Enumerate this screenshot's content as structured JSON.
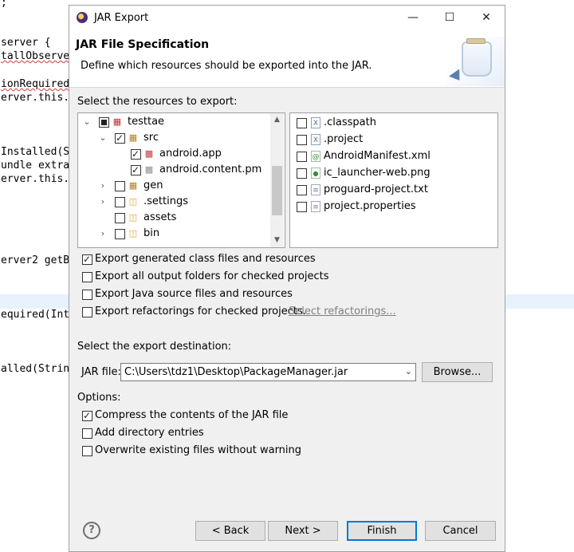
{
  "editor": {
    "lines": [
      ";",
      "server {",
      "tallObserve",
      "ionRequired",
      "erver.this.",
      "Installed(S",
      "undle extra",
      "erver.this.",
      "erver2 getB",
      "equired(Int",
      "alled(Strin"
    ]
  },
  "dialog": {
    "title": "JAR Export",
    "header": {
      "title": "JAR File Specification",
      "description": "Define which resources should be exported into the JAR."
    },
    "resources_label": "Select the resources to export:",
    "tree": [
      {
        "label": "testtae",
        "state": "partial",
        "expanded": true,
        "icon": "project-icon"
      },
      {
        "label": "src",
        "state": "checked",
        "expanded": true,
        "icon": "source-folder-icon"
      },
      {
        "label": "android.app",
        "state": "checked",
        "icon": "package-icon"
      },
      {
        "label": "android.content.pm",
        "state": "checked",
        "icon": "package-empty-icon"
      },
      {
        "label": "gen",
        "state": "unchecked",
        "expanded": false,
        "icon": "source-folder-icon"
      },
      {
        "label": ".settings",
        "state": "unchecked",
        "expanded": false,
        "icon": "folder-icon"
      },
      {
        "label": "assets",
        "state": "unchecked",
        "icon": "folder-icon"
      },
      {
        "label": "bin",
        "state": "unchecked",
        "expanded": false,
        "icon": "folder-icon"
      }
    ],
    "files": [
      {
        "label": ".classpath",
        "checked": false,
        "icon": "xml-file-icon"
      },
      {
        "label": ".project",
        "checked": false,
        "icon": "xml-file-icon"
      },
      {
        "label": "AndroidManifest.xml",
        "checked": false,
        "icon": "android-manifest-icon"
      },
      {
        "label": "ic_launcher-web.png",
        "checked": false,
        "icon": "image-file-icon"
      },
      {
        "label": "proguard-project.txt",
        "checked": false,
        "icon": "text-file-icon"
      },
      {
        "label": "project.properties",
        "checked": false,
        "icon": "text-file-icon"
      }
    ],
    "export_options": [
      {
        "label": "Export generated class files and resources",
        "checked": true
      },
      {
        "label": "Export all output folders for checked projects",
        "checked": false
      },
      {
        "label": "Export Java source files and resources",
        "checked": false
      },
      {
        "label": "Export refactorings for checked projects.",
        "checked": false
      }
    ],
    "select_refactorings_link": "Select refactorings...",
    "destination_label": "Select the export destination:",
    "jar_file_label": "JAR file:",
    "jar_file_value": "C:\\Users\\tdz1\\Desktop\\PackageManager.jar",
    "browse_label": "Browse...",
    "options_label": "Options:",
    "options": [
      {
        "label": "Compress the contents of the JAR file",
        "checked": true
      },
      {
        "label": "Add directory entries",
        "checked": false
      },
      {
        "label": "Overwrite existing files without warning",
        "checked": false
      }
    ],
    "buttons": {
      "back": "< Back",
      "next": "Next >",
      "finish": "Finish",
      "cancel": "Cancel"
    },
    "help_icon": "?"
  }
}
